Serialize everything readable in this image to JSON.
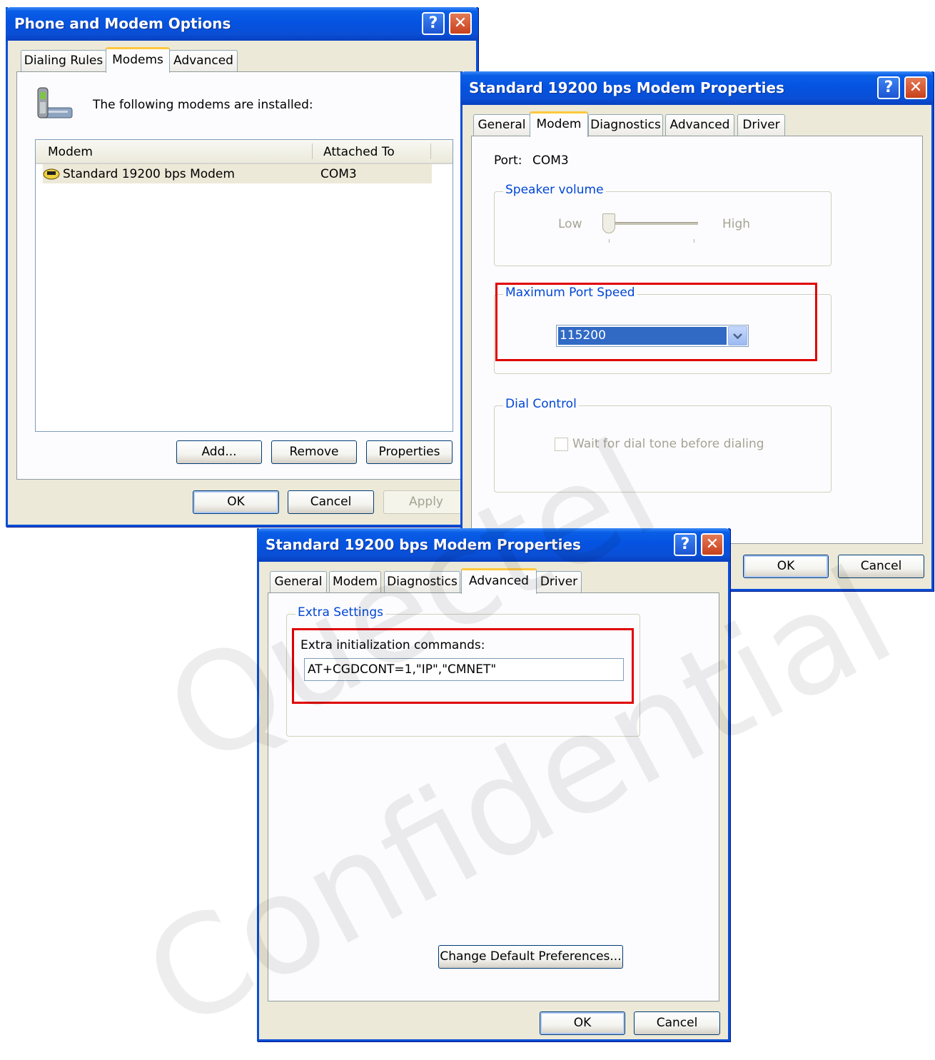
{
  "phone_modem_options": {
    "title": "Phone and Modem Options",
    "tabs": [
      "Dialing Rules",
      "Modems",
      "Advanced"
    ],
    "active_tab": "Modems",
    "intro_text": "The following modems are  installed:",
    "list": {
      "columns": [
        "Modem",
        "Attached To"
      ],
      "rows": [
        {
          "modem": "Standard 19200 bps Modem",
          "attached_to": "COM3"
        }
      ]
    },
    "buttons": {
      "add": "Add...",
      "remove": "Remove",
      "properties": "Properties"
    },
    "footer": {
      "ok": "OK",
      "cancel": "Cancel",
      "apply": "Apply"
    }
  },
  "modem_properties_modem_tab": {
    "title": "Standard 19200 bps Modem Properties",
    "tabs": [
      "General",
      "Modem",
      "Diagnostics",
      "Advanced",
      "Driver"
    ],
    "active_tab": "Modem",
    "port_label": "Port:",
    "port_value": "COM3",
    "speaker_volume": {
      "label": "Speaker volume",
      "low": "Low",
      "high": "High",
      "level": 0
    },
    "max_port_speed": {
      "label": "Maximum Port Speed",
      "value": "115200"
    },
    "dial_control": {
      "label": "Dial Control",
      "checkbox_label": "Wait for dial tone before dialing",
      "checked": false
    },
    "footer": {
      "ok": "OK",
      "cancel": "Cancel"
    }
  },
  "modem_properties_advanced_tab": {
    "title": "Standard 19200 bps Modem Properties",
    "tabs": [
      "General",
      "Modem",
      "Diagnostics",
      "Advanced",
      "Driver"
    ],
    "active_tab": "Advanced",
    "extra_settings": {
      "label": "Extra Settings",
      "commands_label": "Extra initialization commands:",
      "commands_value": "AT+CGDCONT=1,\"IP\",\"CMNET\""
    },
    "change_defaults_button": "Change Default Preferences...",
    "footer": {
      "ok": "OK",
      "cancel": "Cancel"
    }
  },
  "title_buttons": {
    "help": "?",
    "close": "✕"
  },
  "watermark": [
    "Quectel",
    "Confidential"
  ],
  "colors": {
    "titlebar": "#0a4fd6",
    "dialog_bg": "#ece9d8",
    "highlight": "#e00000",
    "selection": "#316ac5"
  }
}
